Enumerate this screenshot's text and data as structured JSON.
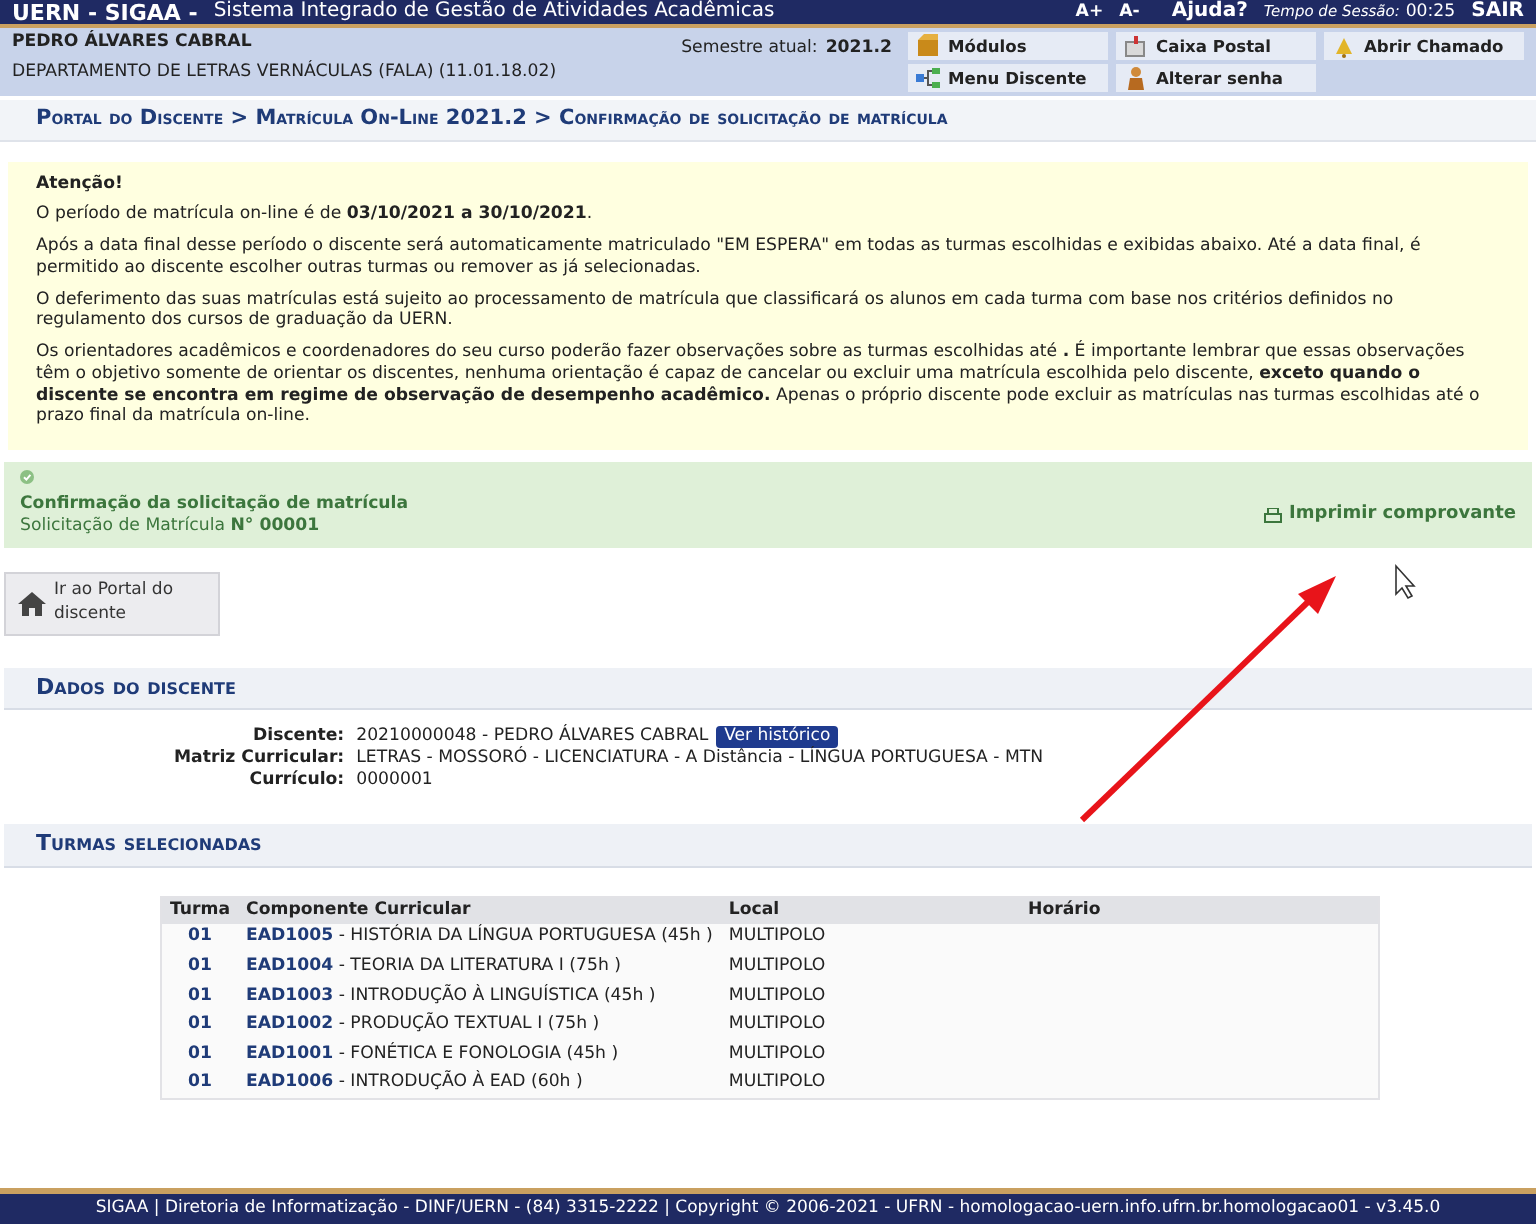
{
  "top_bar": {
    "logo": "UERN - SIGAA -",
    "system_name": "Sistema Integrado de Gestão de Atividades Acadêmicas",
    "font_up": "A+",
    "font_down": "A-",
    "help": "Ajuda?",
    "session_label": "Tempo de Sessão:",
    "session_time": "00:25",
    "logout": "SAIR"
  },
  "user_info": {
    "name": "PEDRO ÁLVARES CABRAL",
    "department": "DEPARTAMENTO DE LETRAS VERNÁCULAS (FALA) (11.01.18.02)",
    "semester_label": "Semestre atual:",
    "semester": "2021.2"
  },
  "shortcuts": [
    {
      "label": "Módulos",
      "kind": "box"
    },
    {
      "label": "Caixa Postal",
      "kind": "mail"
    },
    {
      "label": "Abrir Chamado",
      "kind": "bell"
    },
    {
      "label": "Menu Discente",
      "kind": "tree"
    },
    {
      "label": "Alterar senha",
      "kind": "person"
    }
  ],
  "breadcrumb": "Portal do Discente > Matrícula On-Line 2021.2 > Confirmação de solicitação de matrícula",
  "notice": {
    "title": "Atenção!",
    "paragraphs": [
      "O período de matrícula on-line é de **03/10/2021 a 30/10/2021**.",
      "Após a data final desse período o discente será automaticamente matriculado \"EM ESPERA\" em todas as turmas escolhidas e exibidas abaixo. Até a data final, é permitido ao discente escolher outras turmas ou remover as já selecionadas.",
      "O deferimento das suas matrículas está sujeito ao processamento de matrícula que classificará os alunos em cada turma com base nos critérios definidos no regulamento dos cursos de graduação da UERN.",
      "Os orientadores acadêmicos e coordenadores do seu curso poderão fazer observações sobre as turmas escolhidas até **.** É importante lembrar que essas observações têm o objetivo somente de orientar os discentes, nenhuma orientação é capaz de cancelar ou excluir uma matrícula escolhida pelo discente, **exceto quando o discente se encontra em regime de observação de desempenho acadêmico.** Apenas o próprio discente pode excluir as matrículas nas turmas escolhidas até o prazo final da matrícula on-line."
    ]
  },
  "confirmation": {
    "title": "Confirmação da solicitação de matrícula",
    "subtitle": "Solicitação de Matrícula **N° 00001**",
    "print_link": "Imprimir comprovante"
  },
  "portal_button": "Ir ao Portal do discente",
  "student_section": {
    "heading": "Dados do discente",
    "fields": [
      {
        "label": "Discente:",
        "value": "20210000048 - PEDRO ÁLVARES CABRAL",
        "action": "Ver histórico"
      },
      {
        "label": "Matriz Curricular:",
        "value": "LETRAS - MOSSORÓ - LICENCIATURA - A Distância - LÍNGUA PORTUGUESA - MTN"
      },
      {
        "label": "Currículo:",
        "value": "0000001"
      }
    ]
  },
  "classes_section": {
    "heading": "Turmas selecionadas",
    "columns": [
      "Turma",
      "Componente Curricular",
      "Local",
      "Horário"
    ],
    "rows": [
      {
        "turma": "01",
        "code": "EAD1005",
        "name": "- HISTÓRIA DA LÍNGUA PORTUGUESA (45h )",
        "local": "MULTIPOLO"
      },
      {
        "turma": "01",
        "code": "EAD1004",
        "name": "- TEORIA DA LITERATURA I (75h )",
        "local": "MULTIPOLO"
      },
      {
        "turma": "01",
        "code": "EAD1003",
        "name": "- INTRODUÇÃO À LINGUÍSTICA (45h )",
        "local": "MULTIPOLO"
      },
      {
        "turma": "01",
        "code": "EAD1002",
        "name": "- PRODUÇÃO TEXTUAL I (75h )",
        "local": "MULTIPOLO"
      },
      {
        "turma": "01",
        "code": "EAD1001",
        "name": "- FONÉTICA E FONOLOGIA (45h )",
        "local": "MULTIPOLO"
      },
      {
        "turma": "01",
        "code": "EAD1006",
        "name": "- INTRODUÇÃO À EAD (60h )",
        "local": "MULTIPOLO"
      }
    ]
  },
  "footer": "SIGAA | Diretoria de Informatização - DINF/UERN - (84) 3315-2222 | Copyright © 2006-2021 - UFRN - homologacao-uern.info.ufrn.br.homologacao01 - v3.45.0"
}
